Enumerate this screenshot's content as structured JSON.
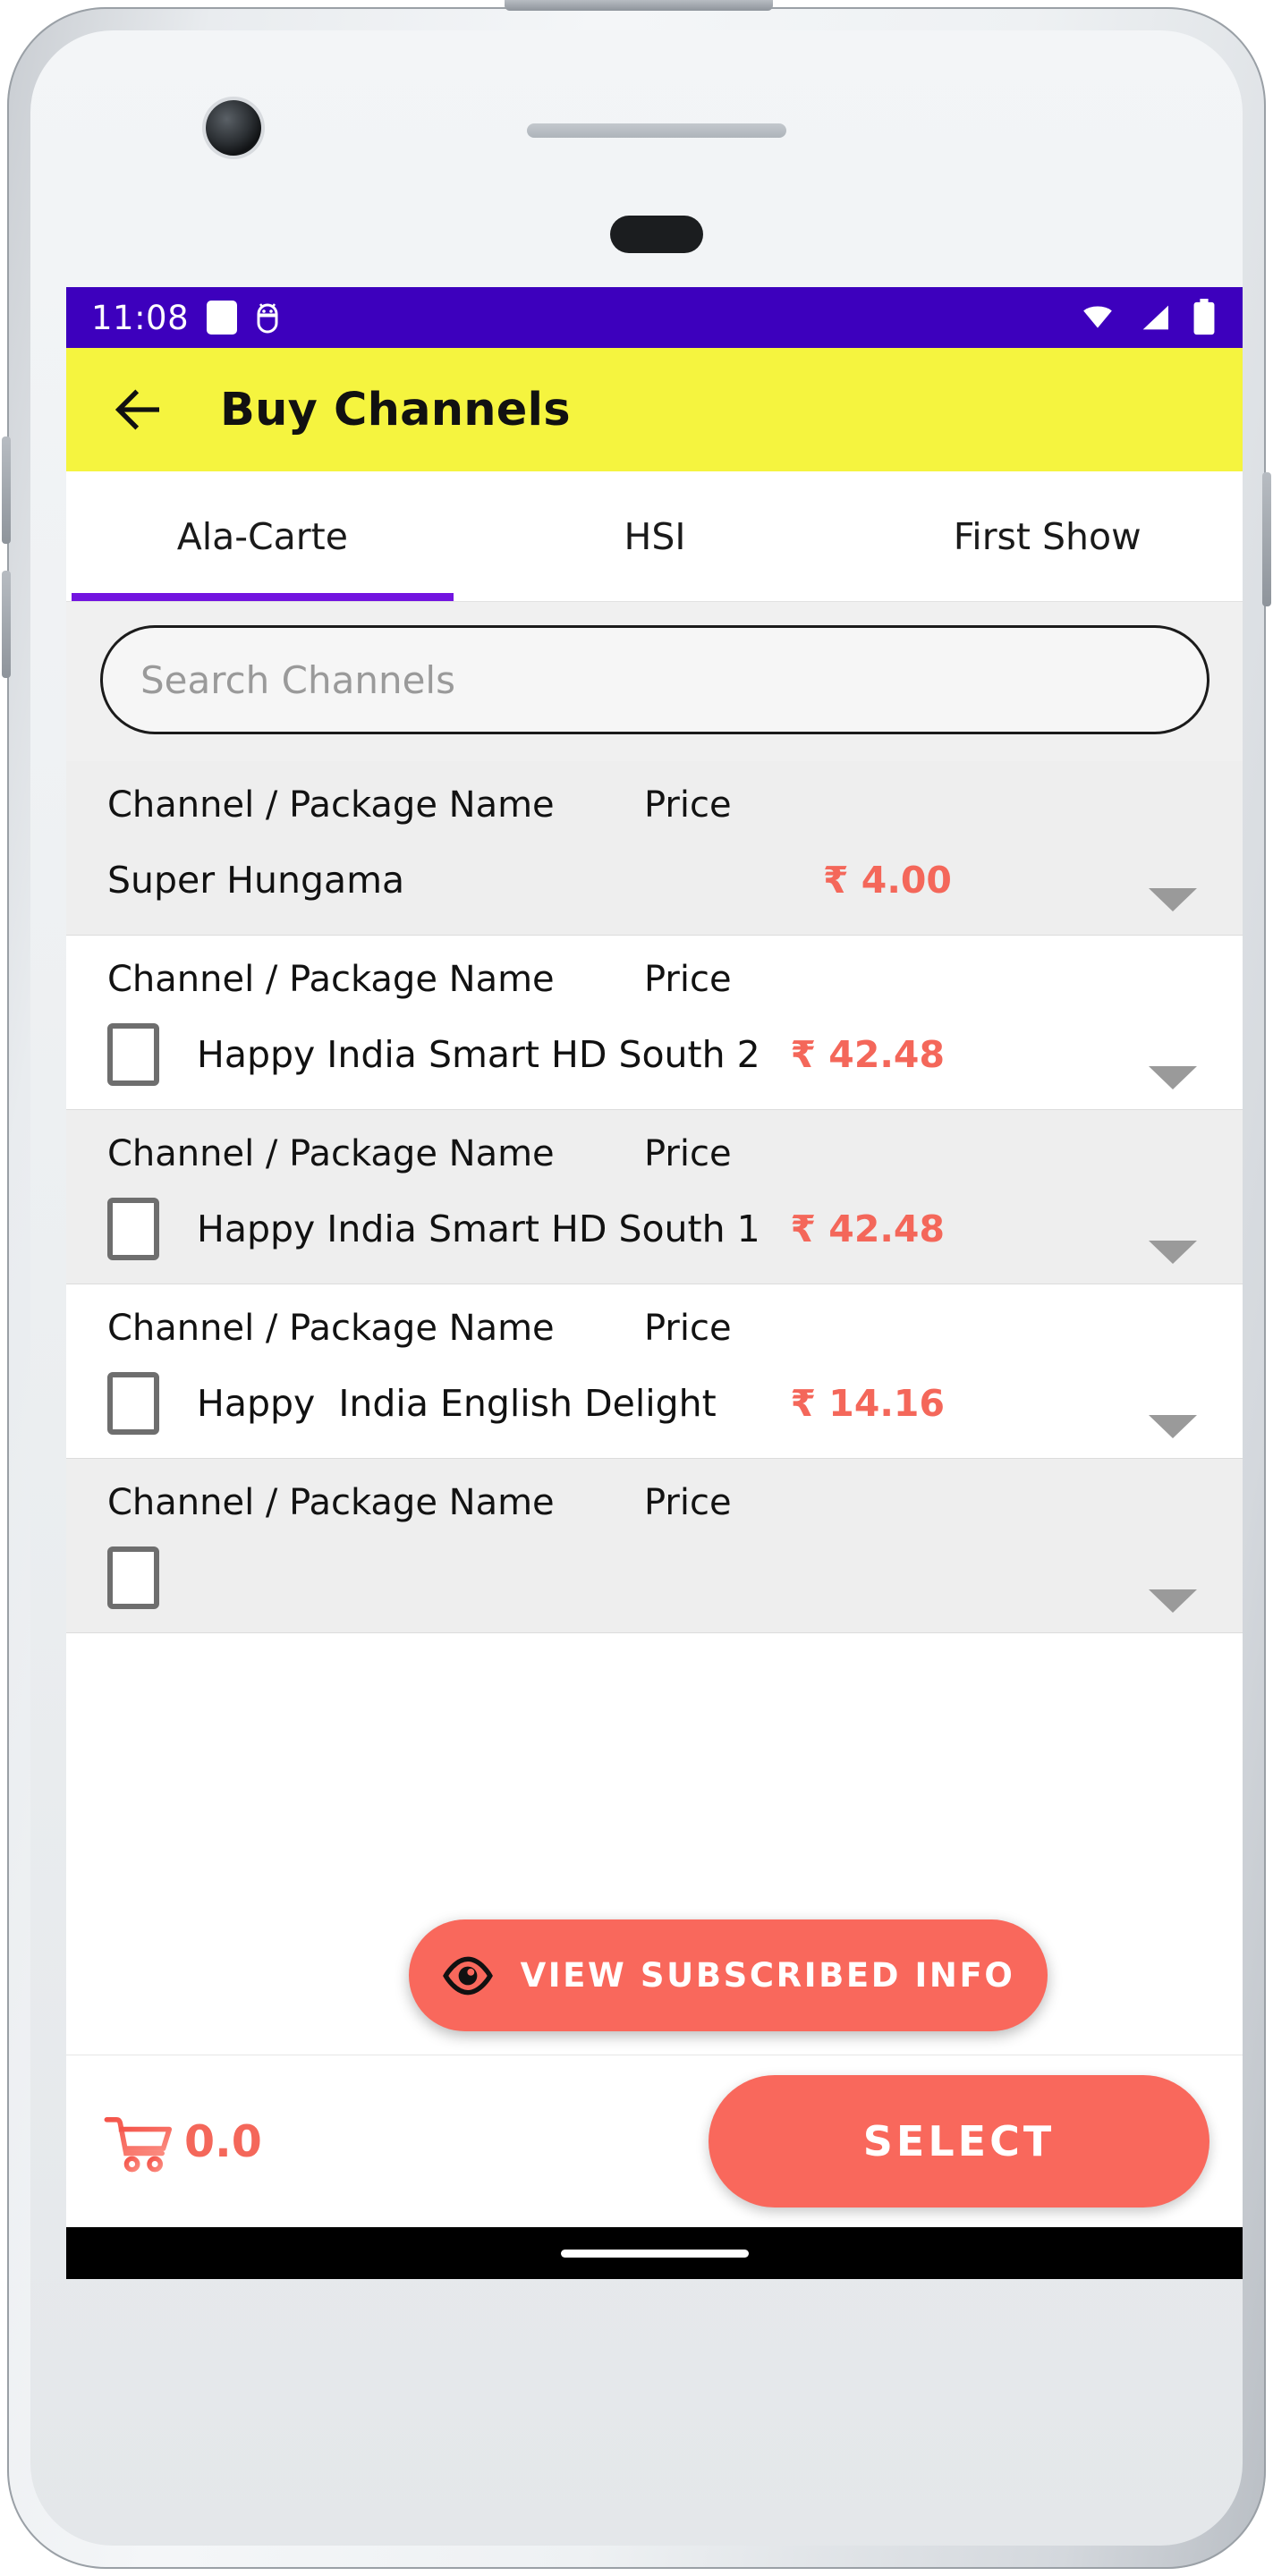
{
  "status_bar": {
    "time": "11:08",
    "left_icons": [
      "white-square-icon",
      "android-head-icon"
    ],
    "right_icons": [
      "wifi-icon",
      "cell-signal-icon",
      "battery-icon"
    ],
    "background_color": "#3D00BD"
  },
  "app_bar": {
    "back_icon": "back-arrow-icon",
    "title": "Buy Channels",
    "background_color": "#F5F43F"
  },
  "tabs": {
    "active_index": 0,
    "indicator_color": "#7214E0",
    "items": [
      {
        "label": "Ala-Carte"
      },
      {
        "label": "HSI"
      },
      {
        "label": "First Show"
      }
    ]
  },
  "search": {
    "placeholder": "Search Channels",
    "value": ""
  },
  "list": {
    "column_headers": {
      "name": "Channel / Package Name",
      "price": "Price"
    },
    "price_color": "#F4675A",
    "rows": [
      {
        "name": "Super Hungama",
        "price": "₹ 4.00",
        "has_checkbox": false,
        "checked": false,
        "expand_icon": "chevron-down-icon",
        "shade": "grey"
      },
      {
        "name": "Happy India Smart HD South 2",
        "price": "₹ 42.48",
        "has_checkbox": true,
        "checked": false,
        "expand_icon": "chevron-down-icon",
        "shade": "white"
      },
      {
        "name": "Happy India Smart HD South 1",
        "price": "₹ 42.48",
        "has_checkbox": true,
        "checked": false,
        "expand_icon": "chevron-down-icon",
        "shade": "grey"
      },
      {
        "name": "Happy  India English Delight",
        "price": "₹ 14.16",
        "has_checkbox": true,
        "checked": false,
        "expand_icon": "chevron-down-icon",
        "shade": "white"
      },
      {
        "name": "",
        "price": "",
        "has_checkbox": true,
        "checked": false,
        "expand_icon": "chevron-down-icon",
        "shade": "grey"
      }
    ]
  },
  "floating_button": {
    "icon": "eye-icon",
    "label": "VIEW SUBSCRIBED INFO",
    "background_color": "#F9685C"
  },
  "bottom_bar": {
    "cart_icon": "cart-plus-icon",
    "cart_amount": "0.0",
    "select_label": "SELECT",
    "select_color": "#F9685C"
  },
  "nav_bar": {
    "handle": "home-gesture-bar"
  }
}
